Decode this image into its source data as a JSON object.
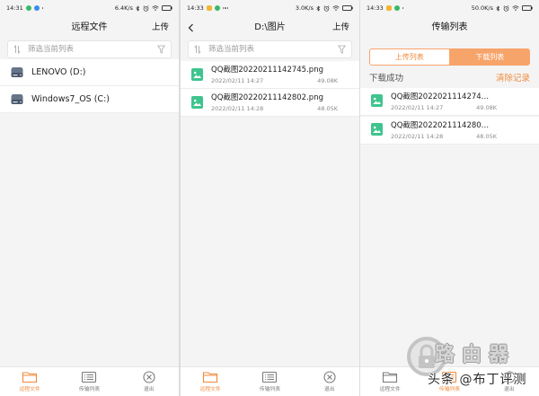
{
  "theme": {
    "accent": "#f08a3c",
    "tab_active_bg": "#f7a46a",
    "file_icon_color": "#3ec48e"
  },
  "status_icons": [
    "bluetooth-icon",
    "alarm-icon",
    "wifi-icon",
    "battery-icon"
  ],
  "screen_remote": {
    "status_bar": {
      "time": "14:31",
      "net_speed": "6.4K/s"
    },
    "header": {
      "title": "远程文件",
      "upload_label": "上传"
    },
    "search": {
      "placeholder": "筛选当前列表",
      "sort_icon": "sort-icon",
      "filter_icon": "filter-icon"
    },
    "drives": [
      {
        "label": "LENOVO (D:)",
        "icon": "hard-drive-icon"
      },
      {
        "label": "Windows7_OS (C:)",
        "icon": "hard-drive-icon"
      }
    ],
    "nav_active": 0
  },
  "screen_folder": {
    "status_bar": {
      "time": "14:33",
      "net_speed": "3.0K/s"
    },
    "header": {
      "title": "D:\\图片",
      "upload_label": "上传",
      "back_icon": "chevron-left-icon"
    },
    "search": {
      "placeholder": "筛选当前列表"
    },
    "files": [
      {
        "name": "QQ截图20220211142745.png",
        "date": "2022/02/11 14:27",
        "size": "49.08K",
        "icon": "image-file-icon"
      },
      {
        "name": "QQ截图20220211142802.png",
        "date": "2022/02/11 14:28",
        "size": "48.05K",
        "icon": "image-file-icon"
      }
    ],
    "nav_active": 0
  },
  "screen_transfer": {
    "status_bar": {
      "time": "14:33",
      "net_speed": "50.0K/s"
    },
    "header": {
      "title": "传输列表"
    },
    "tabs": [
      {
        "label": "上传列表",
        "active": false
      },
      {
        "label": "下载列表",
        "active": true
      }
    ],
    "section": {
      "title": "下载成功",
      "clear_label": "清除记录"
    },
    "items": [
      {
        "name": "QQ截图2022021114274…",
        "date": "2022/02/11 14:27",
        "size": "49.08K",
        "icon": "image-file-icon"
      },
      {
        "name": "QQ截图2022021114280…",
        "date": "2022/02/11 14:28",
        "size": "48.05K",
        "icon": "image-file-icon"
      }
    ],
    "nav_active": 1
  },
  "bottom_nav": {
    "items": [
      {
        "label": "远程文件",
        "icon": "folder-icon"
      },
      {
        "label": "传输列表",
        "icon": "list-icon"
      },
      {
        "label": "退出",
        "icon": "close-circle-icon"
      }
    ]
  },
  "watermark": {
    "logo_text": "路由器",
    "credit": "头条 @布丁评测"
  }
}
